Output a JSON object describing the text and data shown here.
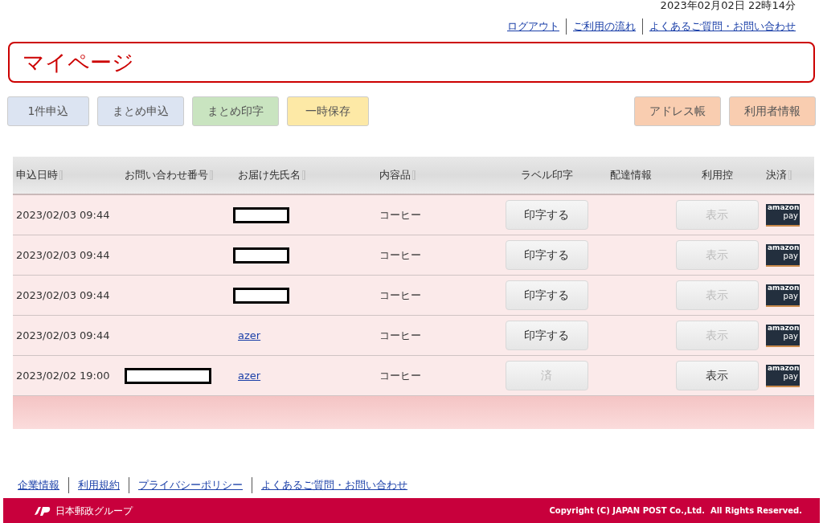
{
  "header": {
    "datetime": "2023年02月02日 22時14分",
    "links": [
      "ログアウト",
      "ご利用の流れ",
      "よくあるご質問・お問い合わせ"
    ]
  },
  "page_title": "マイページ",
  "actions_left": [
    {
      "label": "1件申込",
      "color": "#dce4f2"
    },
    {
      "label": "まとめ申込",
      "color": "#dce4f2"
    },
    {
      "label": "まとめ印字",
      "color": "#c9e4c0"
    },
    {
      "label": "一時保存",
      "color": "#fde9a6"
    }
  ],
  "actions_right": [
    {
      "label": "アドレス帳",
      "color": "#f9cdb0"
    },
    {
      "label": "利用者情報",
      "color": "#f9cdb0"
    }
  ],
  "table": {
    "columns": [
      {
        "label": "申込日時",
        "sortable": true
      },
      {
        "label": "お問い合わせ番号",
        "sortable": true
      },
      {
        "label": "お届け先氏名",
        "sortable": true
      },
      {
        "label": "内容品",
        "sortable": true
      },
      {
        "label": "ラベル印字",
        "sortable": false
      },
      {
        "label": "配達情報",
        "sortable": false
      },
      {
        "label": "利用控",
        "sortable": false
      },
      {
        "label": "決済",
        "sortable": true
      }
    ],
    "rows": [
      {
        "date": "2023/02/03 09:44",
        "tracking": {
          "kind": "empty"
        },
        "recipient": {
          "kind": "redacted"
        },
        "contents": "コーヒー",
        "label_button": {
          "label": "印字する",
          "disabled": false
        },
        "receipt_button": {
          "label": "表示",
          "disabled": true
        },
        "payment": {
          "top": "amazon",
          "bottom": "pay"
        }
      },
      {
        "date": "2023/02/03 09:44",
        "tracking": {
          "kind": "empty"
        },
        "recipient": {
          "kind": "redacted"
        },
        "contents": "コーヒー",
        "label_button": {
          "label": "印字する",
          "disabled": false
        },
        "receipt_button": {
          "label": "表示",
          "disabled": true
        },
        "payment": {
          "top": "amazon",
          "bottom": "pay"
        }
      },
      {
        "date": "2023/02/03 09:44",
        "tracking": {
          "kind": "empty"
        },
        "recipient": {
          "kind": "redacted"
        },
        "contents": "コーヒー",
        "label_button": {
          "label": "印字する",
          "disabled": false
        },
        "receipt_button": {
          "label": "表示",
          "disabled": true
        },
        "payment": {
          "top": "amazon",
          "bottom": "pay"
        }
      },
      {
        "date": "2023/02/03 09:44",
        "tracking": {
          "kind": "empty"
        },
        "recipient": {
          "kind": "link",
          "text": "azer"
        },
        "contents": "コーヒー",
        "label_button": {
          "label": "印字する",
          "disabled": false
        },
        "receipt_button": {
          "label": "表示",
          "disabled": true
        },
        "payment": {
          "top": "amazon",
          "bottom": "pay"
        }
      },
      {
        "date": "2023/02/02 19:00",
        "tracking": {
          "kind": "redacted"
        },
        "recipient": {
          "kind": "link",
          "text": "azer"
        },
        "contents": "コーヒー",
        "label_button": {
          "label": "済",
          "disabled": true
        },
        "receipt_button": {
          "label": "表示",
          "disabled": false
        },
        "payment": {
          "top": "amazon",
          "bottom": "pay"
        }
      }
    ]
  },
  "footer": {
    "links": [
      "企業情報",
      "利用規約",
      "プライバシーポリシー",
      "よくあるご質問・お問い合わせ"
    ],
    "brand": "日本郵政グループ",
    "copyright": "Copyright (C) JAPAN POST Co.,Ltd.  All Rights Reserved."
  }
}
